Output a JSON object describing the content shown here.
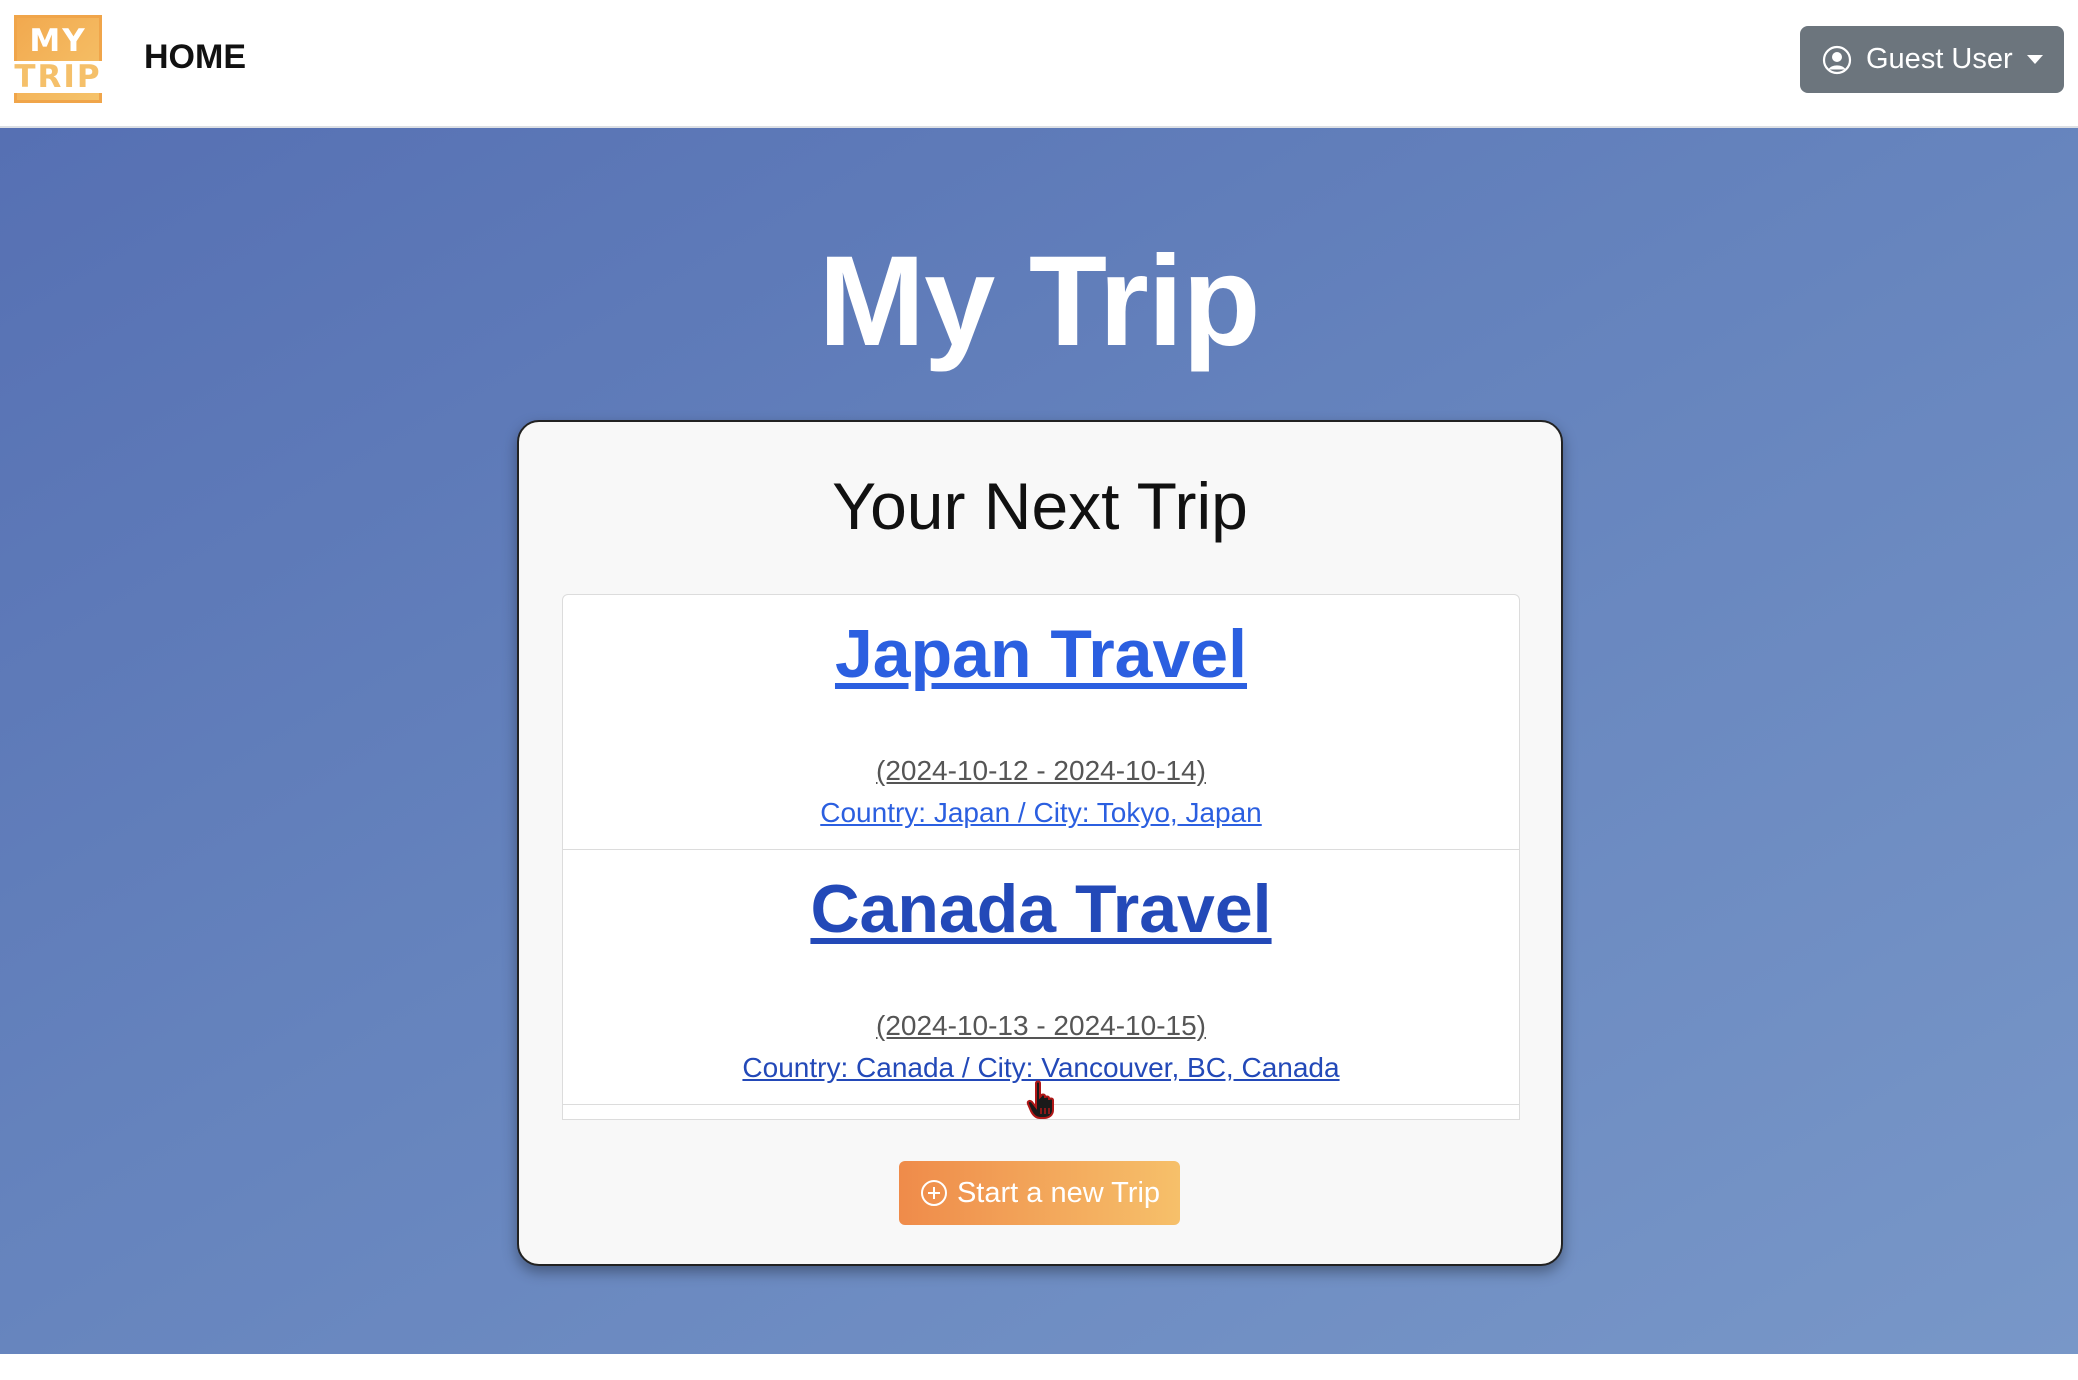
{
  "header": {
    "logo_top": "MY",
    "logo_bottom": "TRIP",
    "home_label": "HOME",
    "user_label": "Guest User"
  },
  "hero": {
    "title": "My Trip"
  },
  "card": {
    "title": "Your Next Trip",
    "trips": [
      {
        "name": "Japan Travel",
        "dates": "(2024-10-12 - 2024-10-14)",
        "location": "Country: Japan / City: Tokyo, Japan"
      },
      {
        "name": "Canada Travel",
        "dates": "(2024-10-13 - 2024-10-15)",
        "location": "Country: Canada / City: Vancouver, BC, Canada"
      }
    ],
    "new_trip_label": "Start a new Trip"
  },
  "colors": {
    "link": "#2b5fe0",
    "accent_orange": "#ef8b4a",
    "hero_blue": "#5f7abb",
    "user_button": "#6c757d"
  },
  "icons": {
    "user": "person-circle-icon",
    "dropdown": "caret-down-icon",
    "new_trip": "plus-circle-icon",
    "cursor": "hand-pointer-icon"
  }
}
